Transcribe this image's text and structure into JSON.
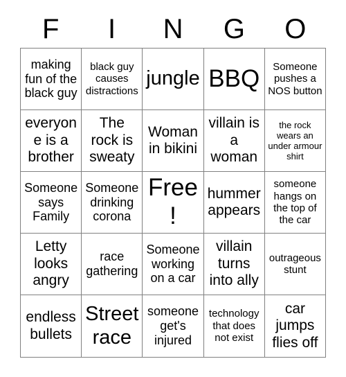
{
  "header": {
    "letters": [
      "F",
      "I",
      "N",
      "G",
      "O"
    ]
  },
  "grid": {
    "rows": [
      [
        {
          "text": "making fun of the black guy",
          "size": "md"
        },
        {
          "text": "black guy causes distractions",
          "size": "sm"
        },
        {
          "text": "jungle",
          "size": "xl"
        },
        {
          "text": "BBQ",
          "size": "xxl"
        },
        {
          "text": "Someone pushes a NOS button",
          "size": "sm"
        }
      ],
      [
        {
          "text": "everyone is a brother",
          "size": "lg"
        },
        {
          "text": "The rock is sweaty",
          "size": "lg"
        },
        {
          "text": "Woman in bikini",
          "size": "lg"
        },
        {
          "text": "villain is a woman",
          "size": "lg"
        },
        {
          "text": "the rock wears an under armour shirt",
          "size": "xs"
        }
      ],
      [
        {
          "text": "Someone says Family",
          "size": "md"
        },
        {
          "text": "Someone drinking corona",
          "size": "md"
        },
        {
          "text": "Free!",
          "size": "xxl"
        },
        {
          "text": "hummer appears",
          "size": "lg"
        },
        {
          "text": "someone hangs on the top of the car",
          "size": "sm"
        }
      ],
      [
        {
          "text": "Letty looks angry",
          "size": "lg"
        },
        {
          "text": "race gathering",
          "size": "md"
        },
        {
          "text": "Someone working on a car",
          "size": "md"
        },
        {
          "text": "villain turns into ally",
          "size": "lg"
        },
        {
          "text": "outrageous stunt",
          "size": "sm"
        }
      ],
      [
        {
          "text": "endless bullets",
          "size": "lg"
        },
        {
          "text": "Street race",
          "size": "xl"
        },
        {
          "text": "someone get's injured",
          "size": "md"
        },
        {
          "text": "technology that does not exist",
          "size": "sm"
        },
        {
          "text": "car jumps flies off",
          "size": "lg"
        }
      ]
    ]
  }
}
